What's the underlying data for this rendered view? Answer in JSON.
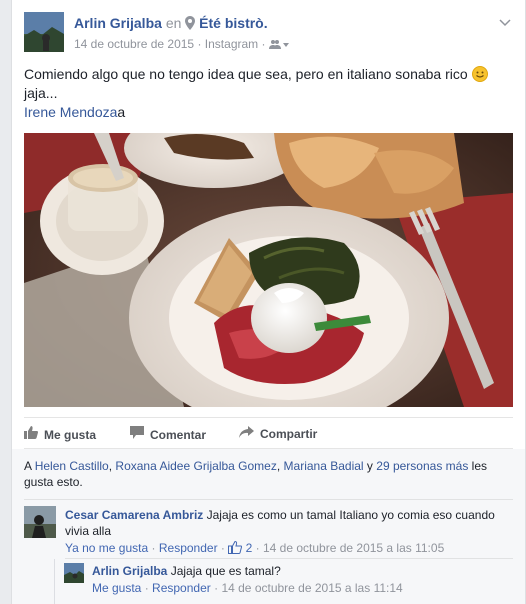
{
  "post": {
    "author": "Arlin Grijalba",
    "at_word": "en",
    "place": "Été bistrò.",
    "date": "14 de octubre de 2015",
    "source": "Instagram",
    "dot": "·",
    "text": "Comiendo algo que no tengo idea que sea, pero en italiano sonaba rico",
    "text2": "jaja...",
    "tag": "Irene Mendoza",
    "tag_suffix": "a"
  },
  "actions": {
    "like": "Me gusta",
    "comment": "Comentar",
    "share": "Compartir"
  },
  "likes": {
    "prefix": "A",
    "names": [
      "Helen Castillo",
      "Roxana Aidee Grijalba Gomez",
      "Mariana Badial"
    ],
    "sep": ",",
    "and": "y",
    "others": "29 personas más",
    "suffix": "les gusta esto."
  },
  "comments": [
    {
      "author": "Cesar Camarena Ambriz",
      "text": "Jajaja es como un tamal Italiano yo comia eso cuando vivia alla",
      "unlike": "Ya no me gusta",
      "reply": "Responder",
      "like_count": "2",
      "time": "14 de octubre de 2015 a las 11:05"
    }
  ],
  "reply": {
    "author": "Arlin Grijalba",
    "text": "Jajaja que es tamal?",
    "like": "Me gusta",
    "reply": "Responder",
    "time": "14 de octubre de 2015 a las 11:14"
  },
  "colors": {
    "link": "#365899",
    "meta": "#90949c",
    "action": "#4b4f56",
    "ufi_bg": "#f6f7f9"
  },
  "icons": [
    "location-pin-icon",
    "audience-icon",
    "chevron-down-icon",
    "like-thumb-icon",
    "comment-icon",
    "share-icon",
    "thumbs-up-count-icon",
    "smile-emoji-icon"
  ]
}
